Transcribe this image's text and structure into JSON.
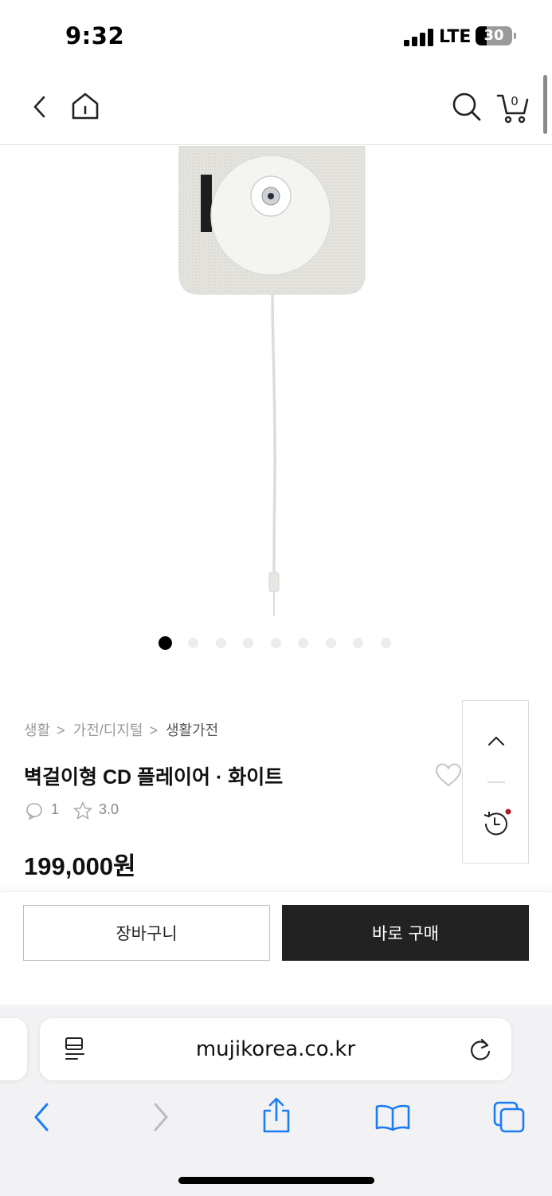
{
  "status_bar": {
    "time": "9:32",
    "network": "LTE",
    "battery": "30"
  },
  "header": {
    "cart_count": "0",
    "icons": [
      "back-chevron-icon",
      "home-icon",
      "search-icon",
      "cart-icon"
    ]
  },
  "product": {
    "image_name": "wall-mounted-cd-player",
    "carousel": {
      "total": 9,
      "active_index": 0
    },
    "breadcrumb": [
      "생활",
      "가전/디지털",
      "생활가전"
    ],
    "title": "벽걸이형 CD 플레이어 · 화이트",
    "review_count": "1",
    "rating": "3.0",
    "price": "199,000원"
  },
  "side_panel": {
    "icons": [
      "scroll-top-chevron-icon",
      "recent-history-icon"
    ],
    "notification_color": "#b01c2e"
  },
  "buy_bar": {
    "cart_label": "장바구니",
    "buy_label": "바로 구매"
  },
  "browser": {
    "url": "mujikorea.co.kr",
    "toolbar_icons": [
      "back-icon",
      "forward-icon",
      "share-icon",
      "bookmarks-icon",
      "tabs-icon"
    ],
    "accent_color": "#1b7cf4"
  }
}
